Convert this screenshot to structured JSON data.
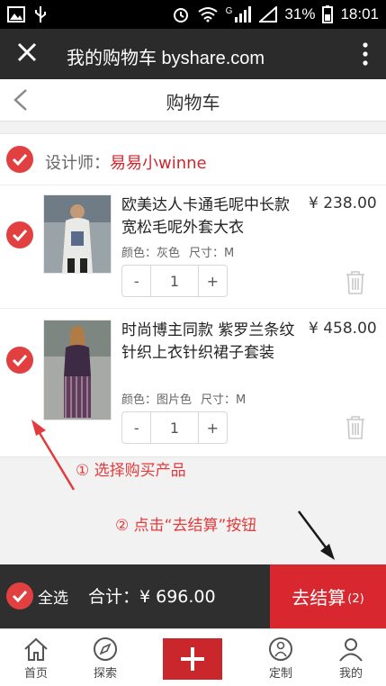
{
  "status_bar": {
    "signal": "G",
    "battery": "31%",
    "time": "18:01"
  },
  "browser": {
    "title": "我的购物车 byshare.com"
  },
  "page": {
    "title": "购物车"
  },
  "designer": {
    "label": "设计师：",
    "name": "易易小winne"
  },
  "items": [
    {
      "title": "欧美达人卡通毛呢中长款宽松毛呢外套大衣",
      "price": "¥ 238.00",
      "color": "颜色：灰色",
      "size": "尺寸：M",
      "quantity": "1"
    },
    {
      "title": "时尚博主同款 紫罗兰条纹针织上衣针织裙子套装",
      "price": "¥ 458.00",
      "color": "颜色：图片色",
      "size": "尺寸：M",
      "quantity": "1"
    }
  ],
  "stepper": {
    "minus": "-",
    "plus": "+"
  },
  "annotations": {
    "step1": "① 选择购买产品",
    "step2": "② 点击“去结算”按钮"
  },
  "summary": {
    "select_all": "全选",
    "total": "合计：¥ 696.00",
    "checkout": "去结算",
    "checkout_count": "(2)"
  },
  "tabs": [
    {
      "label": "首页",
      "icon": "home-icon"
    },
    {
      "label": "探索",
      "icon": "compass-icon"
    },
    {
      "label": "",
      "icon": "plus-icon"
    },
    {
      "label": "定制",
      "icon": "custom-icon"
    },
    {
      "label": "我的",
      "icon": "user-icon"
    }
  ],
  "colors": {
    "accent": "#d8272f",
    "check": "#e24040",
    "dark_bar": "#2f2f2f"
  }
}
